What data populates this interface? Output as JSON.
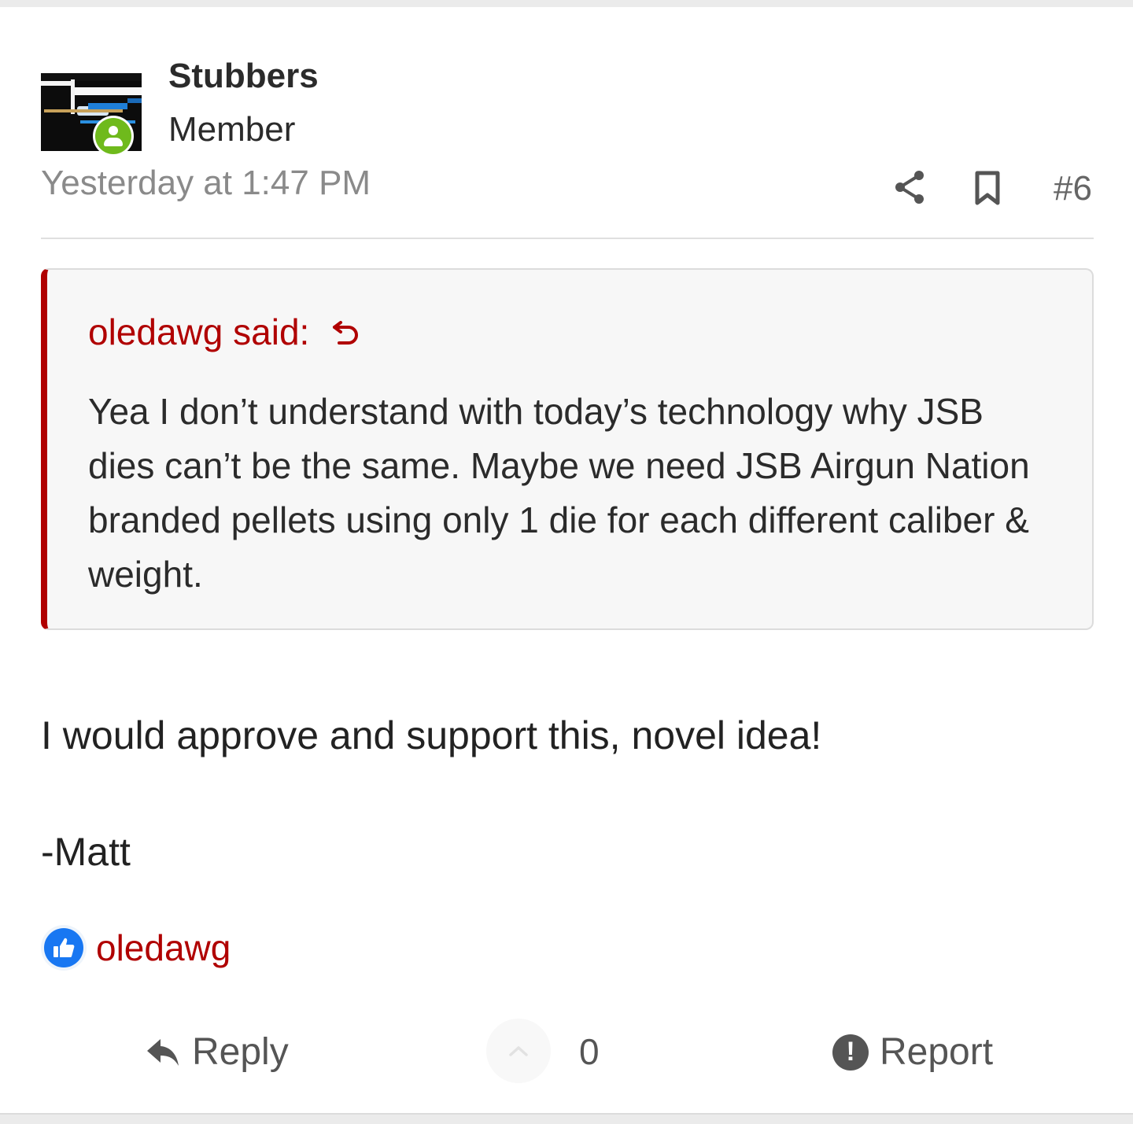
{
  "post": {
    "author": {
      "username": "Stubbers",
      "title": "Member",
      "avatar_icon": "user-avatar-image",
      "status_icon": "online-status-icon",
      "status_color": "#6fba1c"
    },
    "date": "Yesterday at 1:47 PM",
    "share_icon": "share-icon",
    "bookmark_icon": "bookmark-icon",
    "number": "#6",
    "quote": {
      "attribution": "oledawg said:",
      "jump_icon": "quote-jump-icon",
      "text": "Yea I don’t understand with today’s technology why JSB dies can’t be the same. Maybe we need JSB Airgun Nation branded pellets using only 1 die for each different caliber & weight.",
      "accent_color": "#b00000"
    },
    "body": "I would approve and support this, novel idea!",
    "signature": "-Matt",
    "reactions": {
      "icon": "like-icon",
      "user": "oledawg"
    },
    "actions": {
      "reply_label": "Reply",
      "reply_icon": "reply-icon",
      "vote_icon": "upvote-chevron-icon",
      "vote_count": "0",
      "report_label": "Report",
      "report_icon": "report-icon"
    }
  }
}
